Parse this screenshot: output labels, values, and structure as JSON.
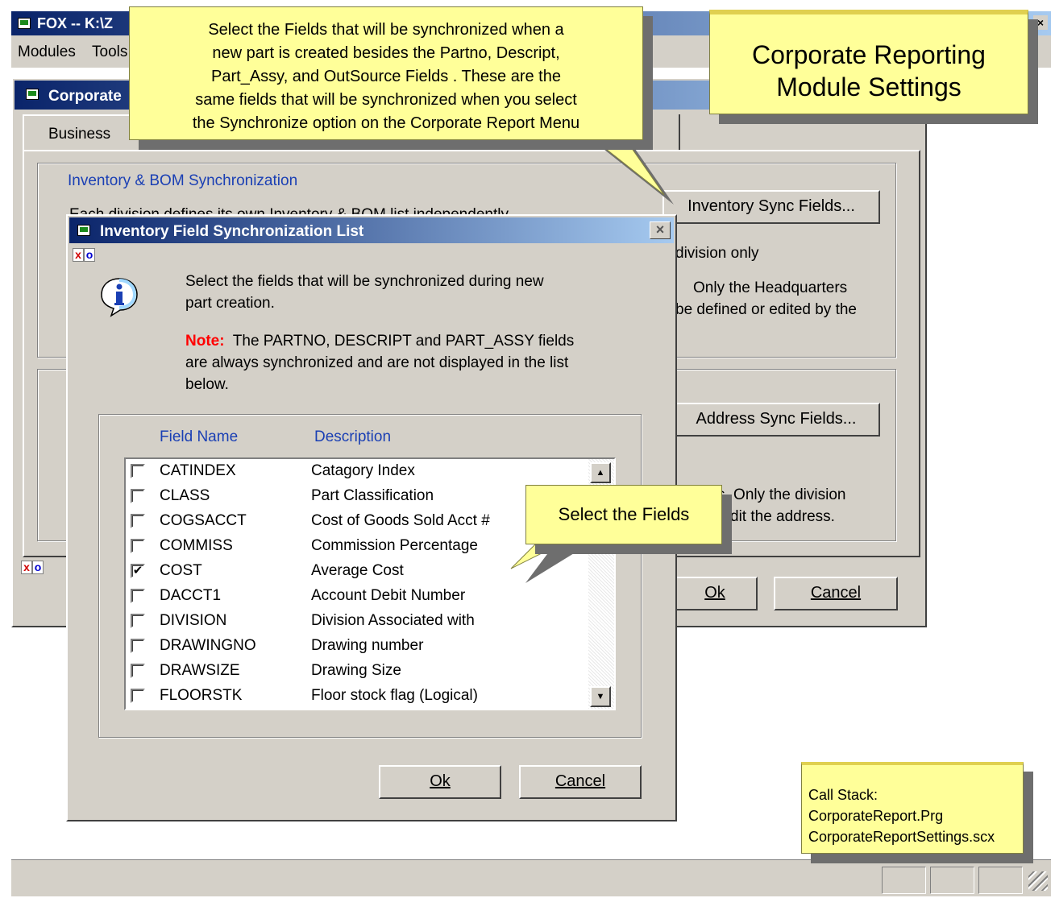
{
  "app": {
    "title": "FOX -- K:\\Z",
    "menu": [
      "Modules",
      "Tools"
    ]
  },
  "corp_window": {
    "title": "Corporate",
    "tab_label": "Business"
  },
  "inventory_group": {
    "title": "Inventory & BOM Synchronization",
    "partial_radio_text": "Each division defines its own Inventory & BOM list independently",
    "sync_button": "Inventory Sync Fields...",
    "text_division_only": "division only",
    "text_hq_1": "Only the Headquarters",
    "text_hq_2": "be defined or edited by the"
  },
  "address_group": {
    "sync_button": "Address Sync Fields...",
    "text_1": "s.  Only the division",
    "text_2": "dit the address."
  },
  "corp_buttons": {
    "ok": "Ok",
    "cancel": "Cancel"
  },
  "callouts": {
    "top": [
      "Select the Fields that will be synchronized when a",
      "new part is created besides the Partno, Descript,",
      "Part_Assy, and OutSource Fields .  These are the",
      "same fields that will be synchronized when you select",
      "the Synchronize option on the Corporate Report Menu"
    ],
    "heading": [
      "Corporate Reporting",
      "Module Settings"
    ],
    "select_fields": "Select the Fields",
    "call_stack": [
      "Call Stack:",
      "CorporateReport.Prg",
      "CorporateReportSettings.scx"
    ]
  },
  "dialog": {
    "title": "Inventory Field Synchronization List",
    "intro": [
      "Select the fields that will be synchronized during new",
      "part creation."
    ],
    "note_label": "Note:",
    "note_text": [
      "The PARTNO, DESCRIPT and PART_ASSY fields",
      "are always synchronized and are not displayed in the list",
      "below."
    ],
    "col_field": "Field Name",
    "col_desc": "Description",
    "rows": [
      {
        "field": "CATINDEX",
        "desc": "Catagory Index",
        "checked": false
      },
      {
        "field": "CLASS",
        "desc": "Part Classification",
        "checked": false
      },
      {
        "field": "COGSACCT",
        "desc": "Cost of Goods Sold Acct #",
        "checked": false
      },
      {
        "field": "COMMISS",
        "desc": "Commission Percentage",
        "checked": false
      },
      {
        "field": "COST",
        "desc": "Average Cost",
        "checked": true
      },
      {
        "field": "DACCT1",
        "desc": "Account Debit Number",
        "checked": false
      },
      {
        "field": "DIVISION",
        "desc": "Division Associated with",
        "checked": false
      },
      {
        "field": "DRAWINGNO",
        "desc": "Drawing number",
        "checked": false
      },
      {
        "field": "DRAWSIZE",
        "desc": "Drawing Size",
        "checked": false
      },
      {
        "field": "FLOORSTK",
        "desc": "Floor stock flag (Logical)",
        "checked": false
      }
    ],
    "ok": "Ok",
    "cancel": "Cancel"
  },
  "icons": {
    "close": "close-icon",
    "info": "info-icon",
    "scroll_up": "scroll-up-arrow-icon",
    "scroll_down": "scroll-down-arrow-icon",
    "check": "checkmark-icon"
  },
  "colors": {
    "title_start": "#0a246a",
    "title_end": "#a6caf0",
    "window_bg": "#d4d0c8",
    "callout_bg": "#ffff99",
    "label_blue": "#1a3fb4",
    "note_red": "#ff0000"
  }
}
